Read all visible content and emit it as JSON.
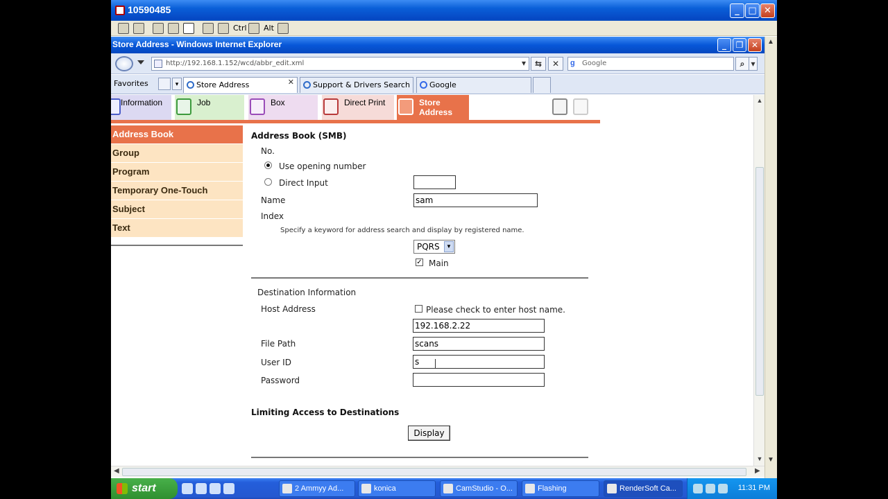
{
  "outer_window": {
    "title": "10590485",
    "toolbar": {
      "ctrl_label": "Ctrl",
      "alt_label": "Alt"
    }
  },
  "ie_window": {
    "title": "Store Address - Windows Internet Explorer",
    "address": "http://192.168.1.152/wcd/abbr_edit.xml",
    "search_placeholder": "Google",
    "favorites_label": "Favorites",
    "tabs": [
      {
        "label": "Store Address"
      },
      {
        "label": "Support & Drivers Search Pa..."
      },
      {
        "label": "Google"
      }
    ]
  },
  "app_nav": {
    "tabs": [
      {
        "label": "Information"
      },
      {
        "label": "Job"
      },
      {
        "label": "Box"
      },
      {
        "label": "Direct Print"
      },
      {
        "label": "Store Address"
      }
    ]
  },
  "sidebar": {
    "items": [
      {
        "label": "Address Book"
      },
      {
        "label": "Group"
      },
      {
        "label": "Program"
      },
      {
        "label": "Temporary One-Touch"
      },
      {
        "label": "Subject"
      },
      {
        "label": "Text"
      }
    ]
  },
  "form": {
    "heading": "Address Book (SMB)",
    "no_label": "No.",
    "opt_opening": "Use opening number",
    "opt_direct": "Direct Input",
    "direct_value": "",
    "name_label": "Name",
    "name_value": "sam",
    "index_label": "Index",
    "index_desc": "Specify a keyword for address search and display by registered name.",
    "index_select": "PQRS",
    "main_label": "Main",
    "dest_heading": "Destination Information",
    "host_label": "Host Address",
    "host_check_label": "Please check to enter host name.",
    "host_value": "192.168.2.22",
    "path_label": "File Path",
    "path_value": "scans",
    "user_label": "User ID",
    "user_value": "s",
    "password_label": "Password",
    "password_value": "",
    "limit_heading": "Limiting Access to Destinations",
    "display_button": "Display"
  },
  "taskbar": {
    "start_label": "start",
    "tasks": [
      {
        "label": "2 Ammyy Ad..."
      },
      {
        "label": "konica"
      },
      {
        "label": "CamStudio - O..."
      },
      {
        "label": "Flashing"
      },
      {
        "label": "RenderSoft Ca..."
      }
    ],
    "clock": "11:31 PM"
  }
}
